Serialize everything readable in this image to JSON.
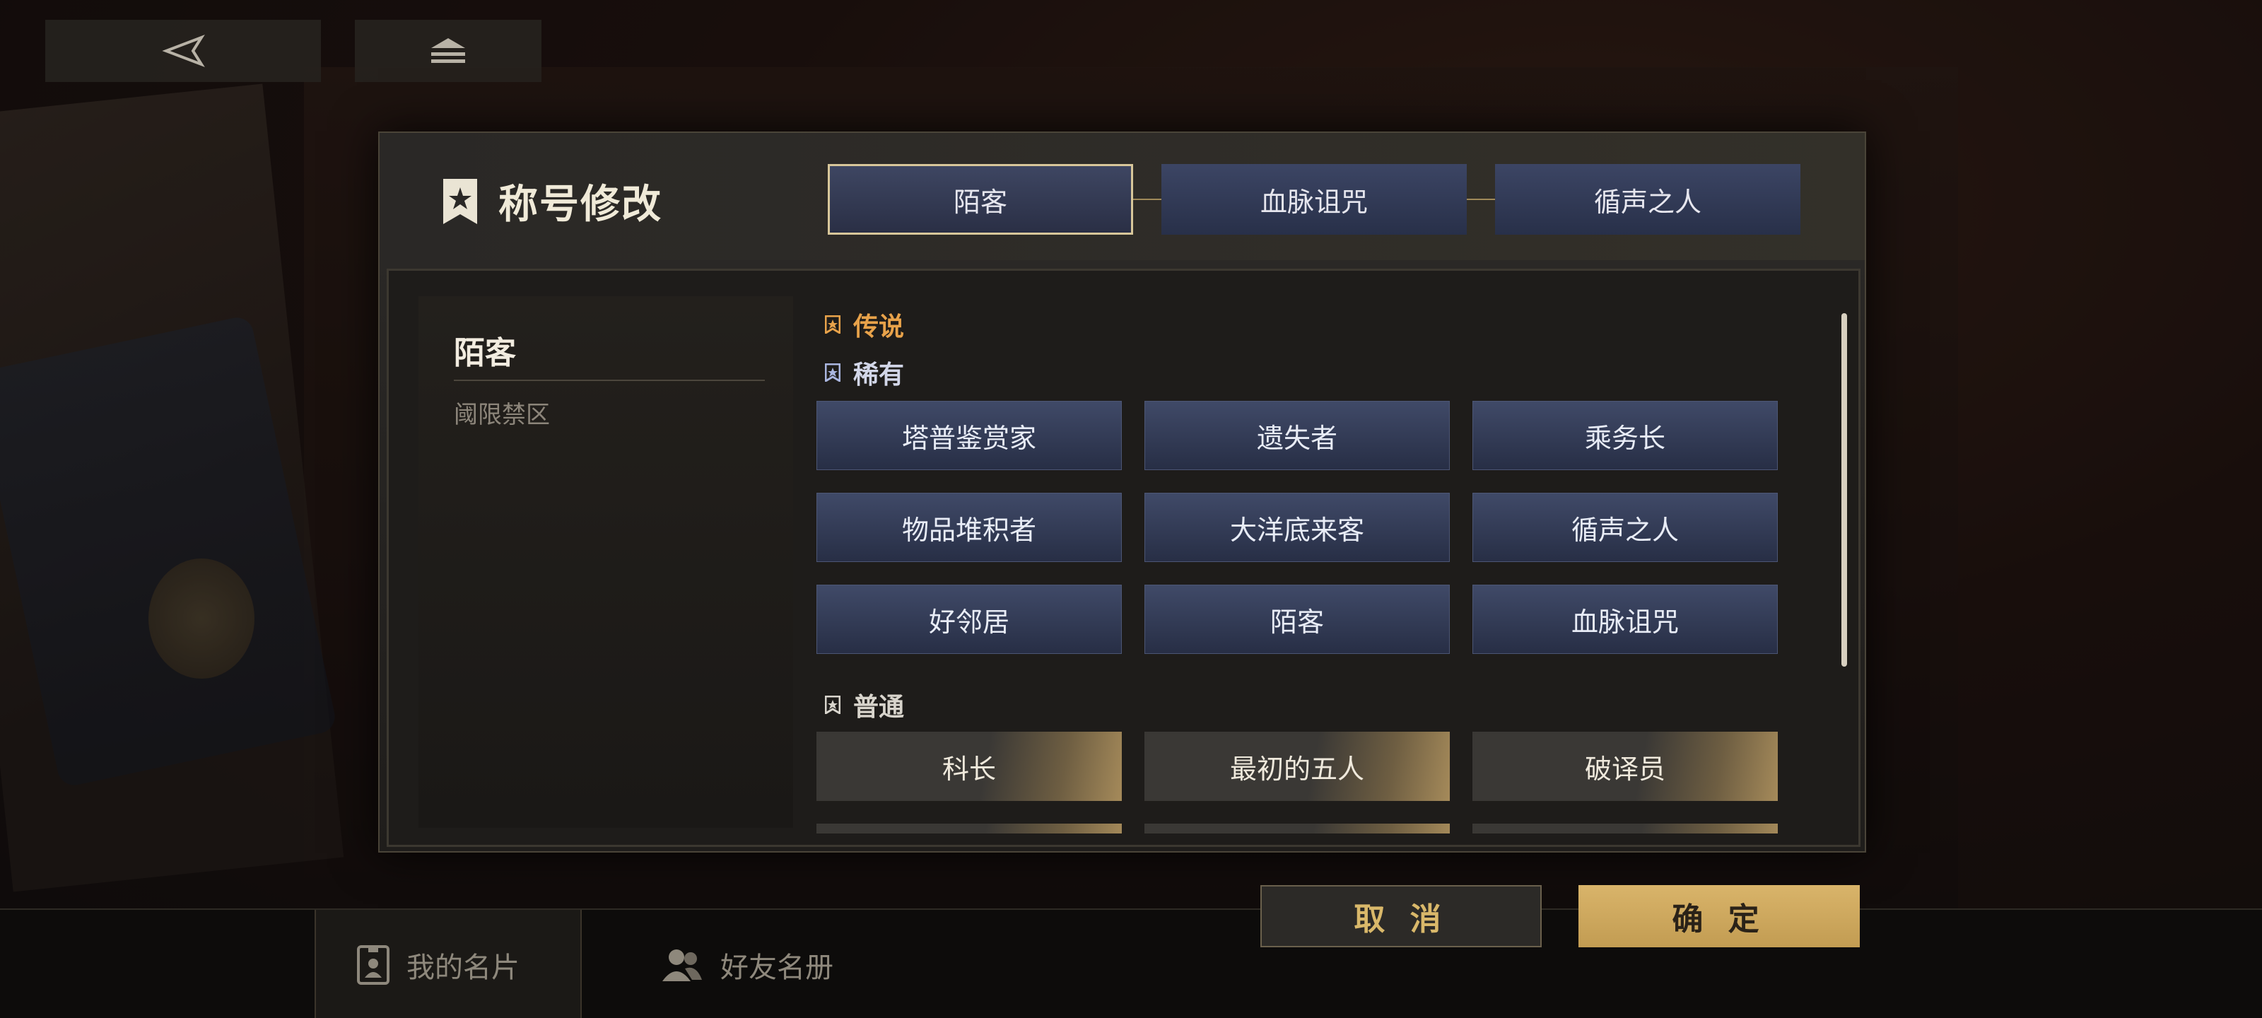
{
  "modal": {
    "title": "称号修改",
    "tabs": [
      {
        "label": "陌客",
        "active": true
      },
      {
        "label": "血脉诅咒",
        "active": false
      },
      {
        "label": "循声之人",
        "active": false
      }
    ]
  },
  "info": {
    "name": "陌客",
    "source": "阈限禁区"
  },
  "sections": {
    "legend": {
      "label": "传说",
      "color": "#e8a24a"
    },
    "rare": {
      "label": "稀有",
      "items": [
        "塔普鉴赏家",
        "遗失者",
        "乘务长",
        "物品堆积者",
        "大洋底来客",
        "循声之人",
        "好邻居",
        "陌客",
        "血脉诅咒"
      ]
    },
    "normal": {
      "label": "普通",
      "items": [
        "科长",
        "最初的五人",
        "破译员"
      ]
    }
  },
  "actions": {
    "cancel": "取 消",
    "confirm": "确 定"
  },
  "bottom_nav": {
    "my_card": "我的名片",
    "friends": "好友名册"
  },
  "icons": {
    "back": "back-arrow-icon",
    "home": "home-icon",
    "title": "bookmark-star-icon"
  },
  "colors": {
    "accent_gold": "#d9b46a",
    "rare_blue": "#3c4564",
    "legend_orange": "#e8a24a"
  }
}
